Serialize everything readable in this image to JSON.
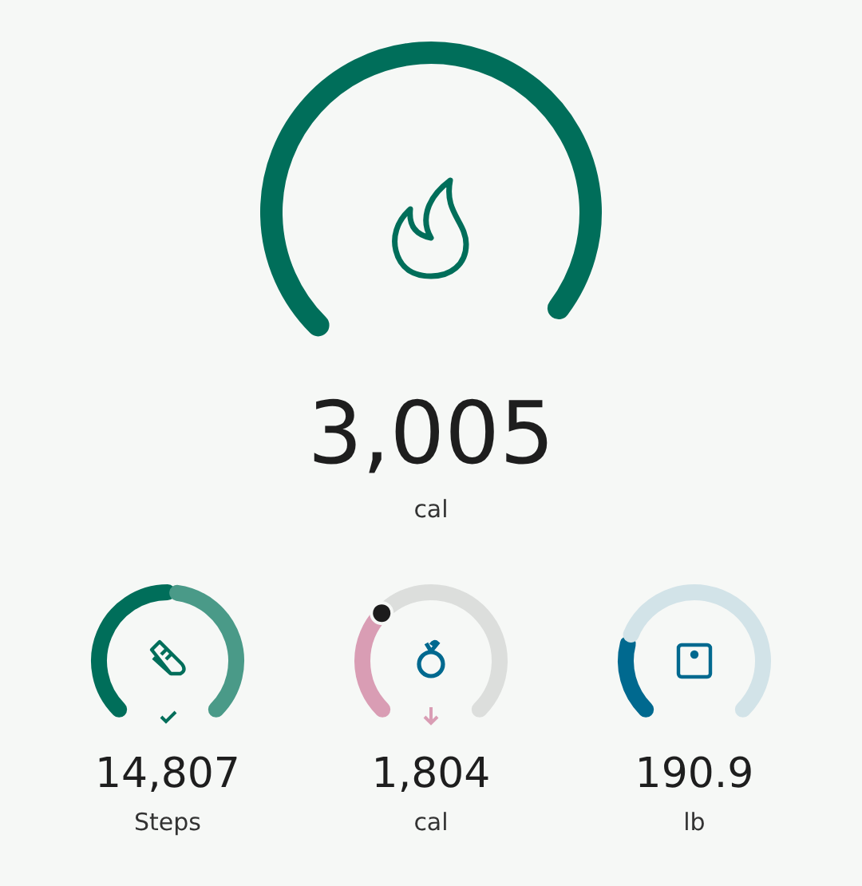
{
  "main": {
    "value": "3,005",
    "unit": "cal"
  },
  "tiles": [
    {
      "kind": "steps",
      "value": "14,807",
      "label": "Steps"
    },
    {
      "kind": "food",
      "value": "1,804",
      "label": "cal"
    },
    {
      "kind": "weight",
      "value": "190.9",
      "label": "lb"
    }
  ]
}
